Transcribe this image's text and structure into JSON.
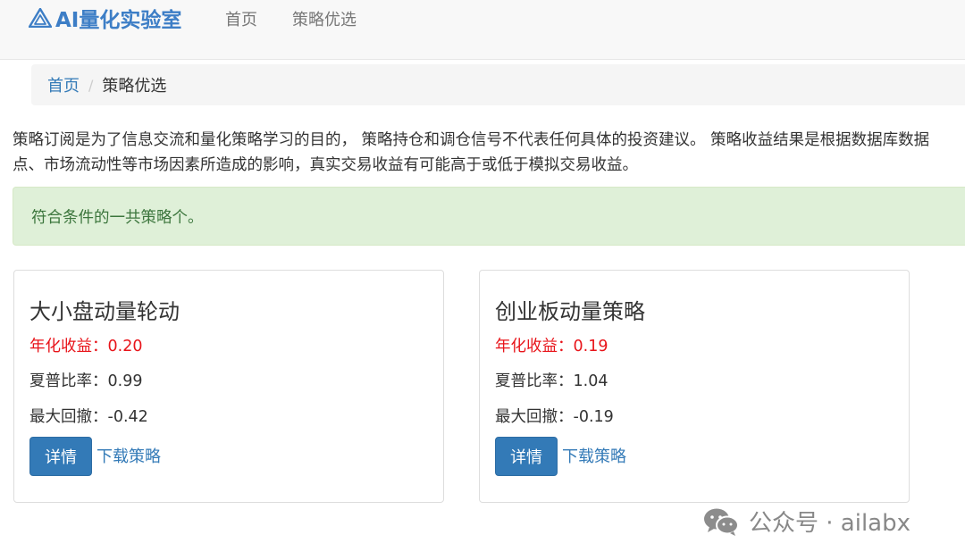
{
  "navbar": {
    "brand": "AI量化实验室",
    "links": [
      "首页",
      "策略优选"
    ]
  },
  "breadcrumb": {
    "home": "首页",
    "separator": "/",
    "current": "策略优选"
  },
  "disclaimer": {
    "line1": "策略订阅是为了信息交流和量化策略学习的目的， 策略持仓和调仓信号不代表任何具体的投资建议。 策略收益结果是根据数据库数据",
    "line2": "点、市场流动性等市场因素所造成的影响，真实交易收益有可能高于或低于模拟交易收益。"
  },
  "alert": {
    "text": "符合条件的一共策略个。"
  },
  "cards": [
    {
      "title": "大小盘动量轮动",
      "annual_return": "年化收益：0.20",
      "sharpe": "夏普比率：0.99",
      "max_drawdown": "最大回撤：-0.42",
      "detail_label": "详情",
      "download_label": "下载策略"
    },
    {
      "title": "创业板动量策略",
      "annual_return": "年化收益：0.19",
      "sharpe": "夏普比率：1.04",
      "max_drawdown": "最大回撤：-0.19",
      "detail_label": "详情",
      "download_label": "下载策略"
    }
  ],
  "watermark": {
    "text": "公众号 · ailabx",
    "icon": "wechat-icon"
  },
  "colors": {
    "brand": "#3d7ec6",
    "link": "#337ab7",
    "return_red": "#e8141a",
    "alert_bg": "#dff0d8",
    "alert_text": "#3c763d"
  }
}
